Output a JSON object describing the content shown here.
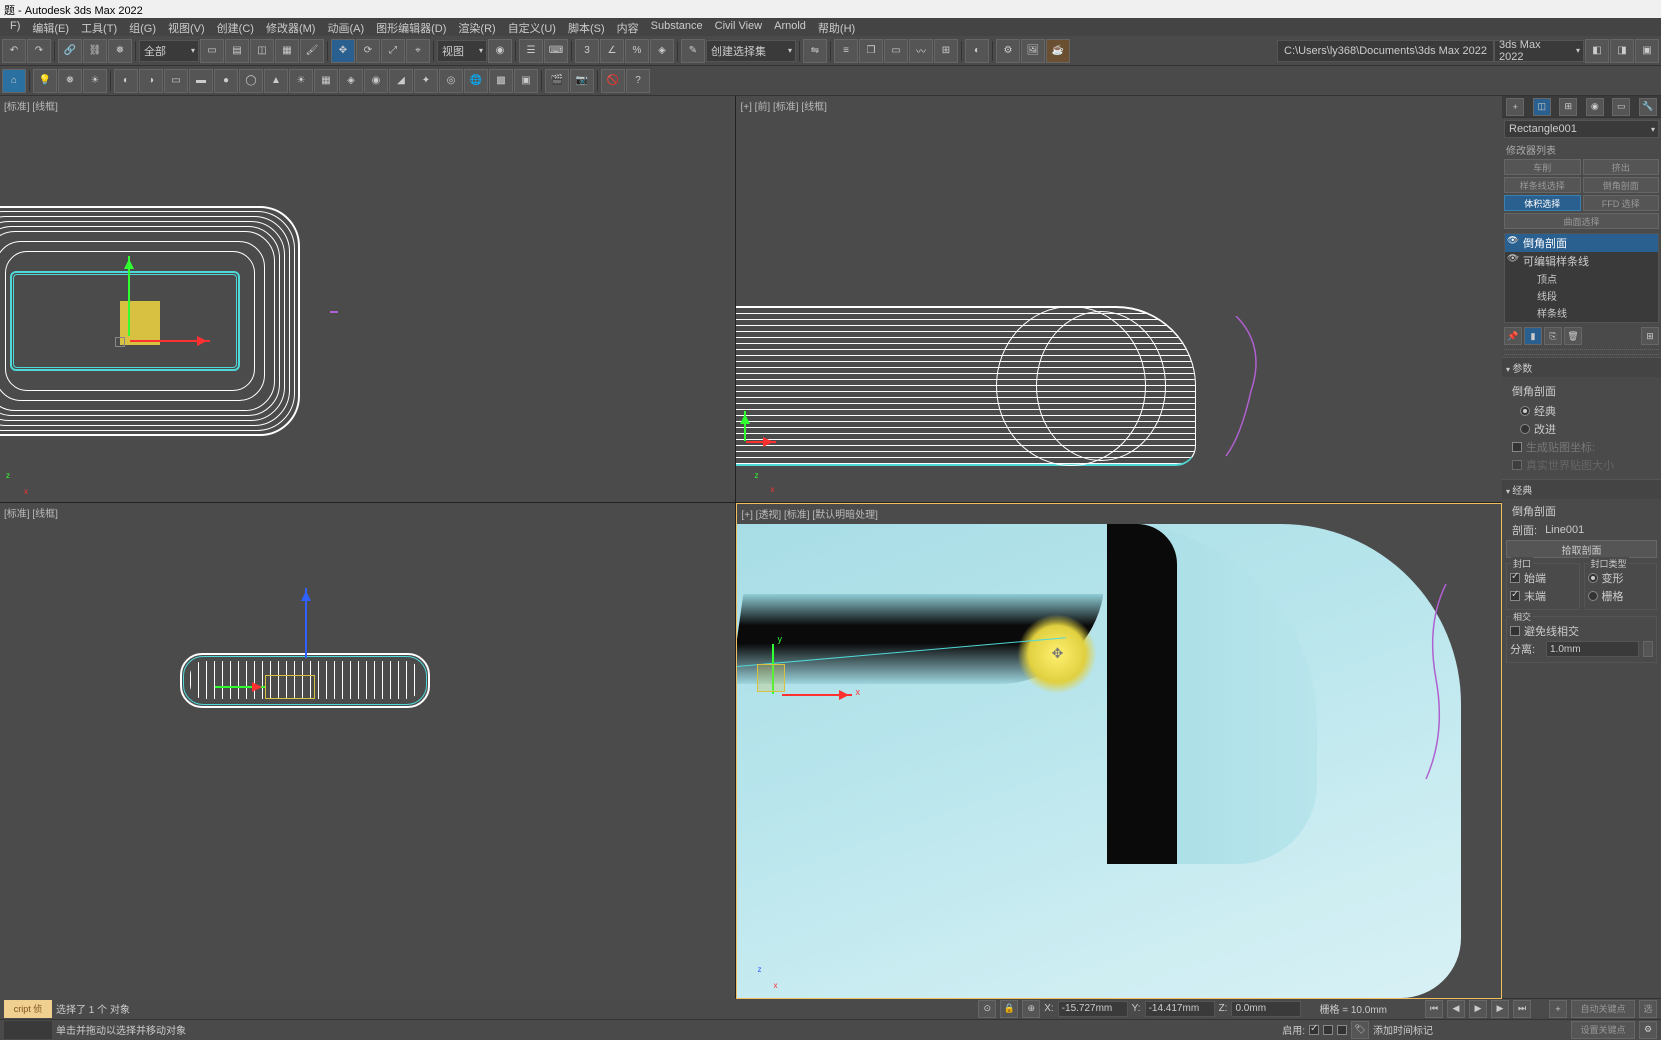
{
  "title": "题 - Autodesk 3ds Max 2022",
  "menu": [
    "F)",
    "编辑(E)",
    "工具(T)",
    "组(G)",
    "视图(V)",
    "创建(C)",
    "修改器(M)",
    "动画(A)",
    "图形编辑器(D)",
    "渲染(R)",
    "自定义(U)",
    "脚本(S)",
    "内容",
    "Substance",
    "Civil View",
    "Arnold",
    "帮助(H)"
  ],
  "toolbar1": {
    "selection_filter": "全部",
    "view_label": "视图",
    "create_sel_set": "创建选择集",
    "workspace": "3ds Max 2022",
    "project_path": "C:\\Users\\ly368\\Documents\\3ds Max 2022"
  },
  "viewports": {
    "top": "[标准] [线框]",
    "front": "[+] [前] [标准] [线框]",
    "left": "[标准] [线框]",
    "persp": "[+] [透视] [标准] [默认明暗处理]"
  },
  "side": {
    "object_name": "Rectangle001",
    "mod_list_label": "修改器列表",
    "btns1": [
      "车削",
      "挤出"
    ],
    "btns2": [
      "样条线选择",
      "倒角剖面"
    ],
    "btns3": [
      "体积选择",
      "FFD 选择"
    ],
    "btns4": "曲面选择",
    "stack": {
      "mod": "倒角剖面",
      "base": "可编辑样条线",
      "sub1": "顶点",
      "sub2": "线段",
      "sub3": "样条线"
    },
    "rollout_params": "参数",
    "section_bevel": "倒角剖面",
    "opt_classic": "经典",
    "opt_improved": "改进",
    "chk_gen_coords": "生成贴图坐标:",
    "chk_real_world": "真实世界贴图大小",
    "rollout_classic": "经典",
    "lbl_bevel2": "倒角剖面",
    "lbl_profile": "剖面:",
    "profile_value": "Line001",
    "btn_pick": "拾取剖面",
    "lbl_cap": "封口",
    "lbl_cap_type": "封口类型",
    "chk_start": "始端",
    "chk_end": "末端",
    "opt_morph": "变形",
    "opt_grid": "栅格",
    "lbl_intersect": "相交",
    "chk_avoid": "避免线相交",
    "lbl_separate": "分离:",
    "separate_value": "1.0mm"
  },
  "status": {
    "selection": "选择了 1 个 对象",
    "prompt": "单击并拖动以选择并移动对象",
    "script": "cript 侦",
    "x_val": "-15.727mm",
    "y_val": "-14.417mm",
    "z_val": "0.0mm",
    "grid": "栅格 = 10.0mm",
    "enable": "启用:",
    "add_time_tag": "添加时间标记",
    "auto_key": "自动关键点",
    "set_key": "设置关键点",
    "sel": "选"
  }
}
